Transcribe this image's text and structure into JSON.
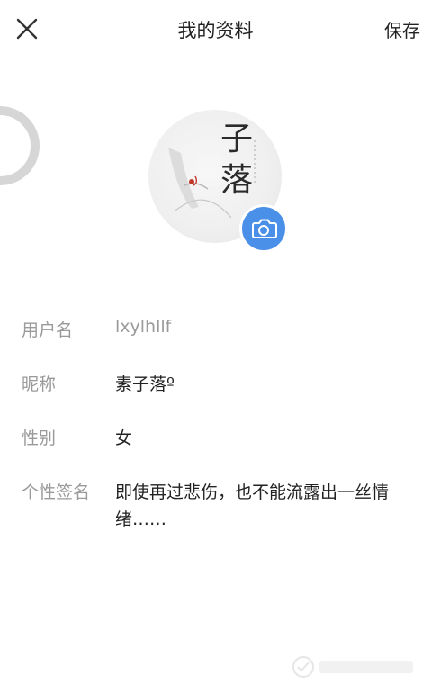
{
  "header": {
    "title": "我的资料",
    "save_label": "保存"
  },
  "icons": {
    "close": "close-icon",
    "camera": "camera-icon"
  },
  "colors": {
    "accent": "#4a90e8",
    "label": "#9a9a9a",
    "text": "#222222"
  },
  "avatar": {
    "title_chars": "子落"
  },
  "profile": {
    "username": {
      "label": "用户名",
      "value": "lxylhllf"
    },
    "nickname": {
      "label": "昵称",
      "value": "素子落º"
    },
    "gender": {
      "label": "性别",
      "value": "女"
    },
    "signature": {
      "label": "个性签名",
      "value": "即使再过悲伤，也不能流露出一丝情绪……"
    }
  }
}
